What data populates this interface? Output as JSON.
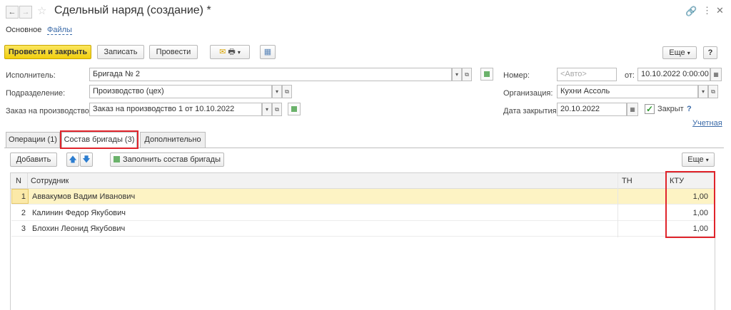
{
  "window": {
    "title": "Сдельный наряд (создание) *",
    "link_icon": "link-icon",
    "menu_icon": "more-vertical-icon",
    "close_icon": "close-icon"
  },
  "nav_tabs": [
    "Основное",
    "Файлы"
  ],
  "toolbar": {
    "post_close": "Провести и закрыть",
    "save": "Записать",
    "post": "Провести",
    "more": "Еще",
    "help": "?"
  },
  "form": {
    "executor_label": "Исполнитель:",
    "executor_value": "Бригада № 2",
    "division_label": "Подразделение:",
    "division_value": "Производство (цех)",
    "order_label": "Заказ на производство:",
    "order_value": "Заказ на производство 1 от 10.10.2022",
    "number_label": "Номер:",
    "number_placeholder": "<Авто>",
    "date_label": "от:",
    "date_value": "10.10.2022  0:00:00",
    "org_label": "Организация:",
    "org_value": "Кухни Ассоль",
    "close_date_label": "Дата закрытия:",
    "close_date_value": "20.10.2022",
    "closed_label": "Закрыт",
    "closed_help": "?",
    "closed_checked": true,
    "accounting_link": "Учетная"
  },
  "tabs": [
    "Операции (1)",
    "Состав бригады (3)",
    "Дополнительно"
  ],
  "active_tab": 1,
  "table_toolbar": {
    "add": "Добавить",
    "fill": "Заполнить состав бригады",
    "more": "Еще"
  },
  "table": {
    "columns": [
      "N",
      "Сотрудник",
      "ТН",
      "КТУ"
    ],
    "rows": [
      {
        "n": "1",
        "employee": "Аввакумов Вадим Иванович",
        "tn": "",
        "ktu": "1,00"
      },
      {
        "n": "2",
        "employee": "Калинин Федор Якубович",
        "tn": "",
        "ktu": "1,00"
      },
      {
        "n": "3",
        "employee": "Блохин Леонид Якубович",
        "tn": "",
        "ktu": "1,00"
      }
    ]
  },
  "colors": {
    "accent": "#f1cf0f",
    "highlight": "#e0242b",
    "selected_row": "#fdf3c4",
    "link": "#3a6aa8"
  }
}
